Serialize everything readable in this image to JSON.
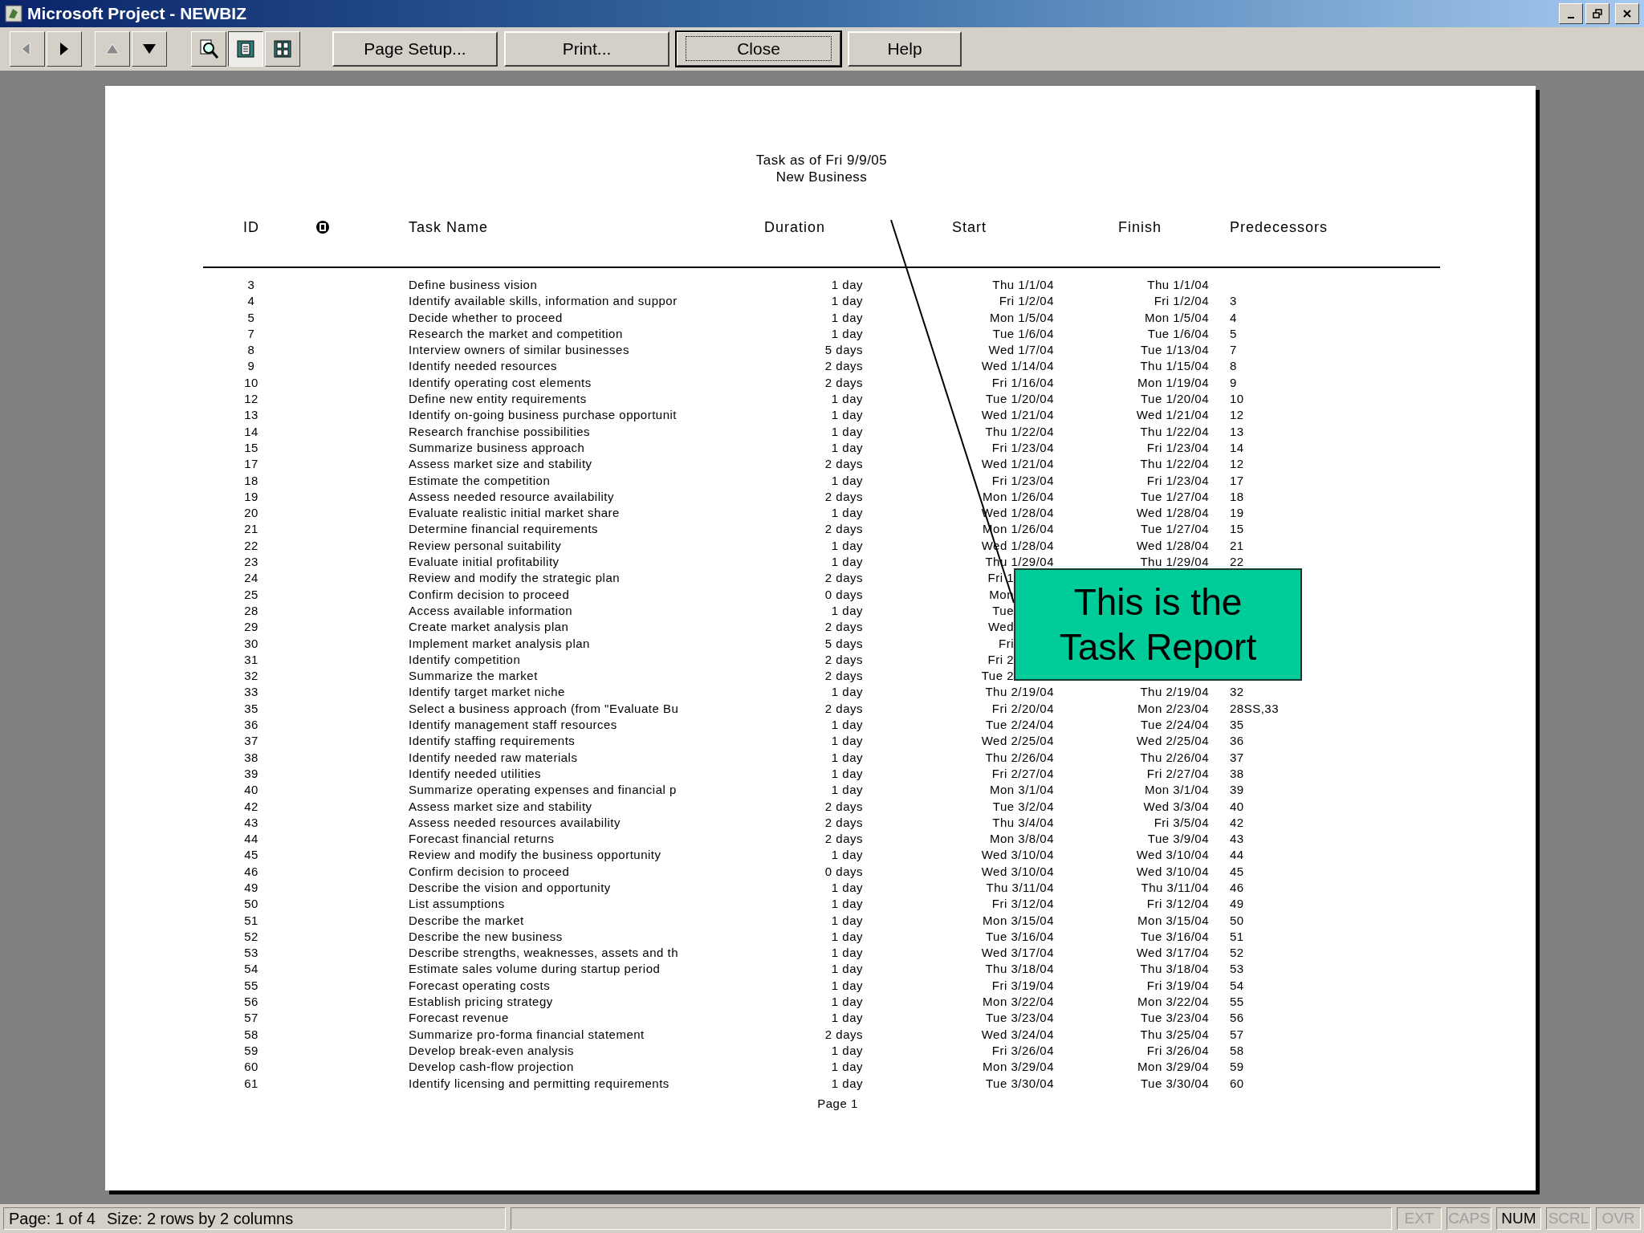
{
  "window": {
    "title": "Microsoft Project - NEWBIZ"
  },
  "toolbar": {
    "nav_buttons": [
      {
        "kind": "left",
        "disabled": true
      },
      {
        "kind": "right",
        "disabled": false
      },
      {
        "kind": "up",
        "disabled": true
      },
      {
        "kind": "down",
        "disabled": false
      }
    ],
    "view_buttons": [
      {
        "kind": "zoom",
        "pressed": false
      },
      {
        "kind": "one-page",
        "pressed": true
      },
      {
        "kind": "multi-page",
        "pressed": false
      }
    ],
    "buttons": [
      {
        "label": "Page Setup...",
        "focused": false
      },
      {
        "label": "Print...",
        "focused": false
      },
      {
        "label": "Close",
        "focused": true
      },
      {
        "label": "Help",
        "focused": false
      }
    ]
  },
  "report": {
    "title": "Task as of Fri 9/9/05",
    "subtitle": "New Business",
    "columns": {
      "id": "ID",
      "name": "Task Name",
      "duration": "Duration",
      "start": "Start",
      "finish": "Finish",
      "predecessors": "Predecessors"
    },
    "rows": [
      {
        "id": "3",
        "name": "Define business vision",
        "duration": "1 day",
        "start": "Thu 1/1/04",
        "finish": "Thu 1/1/04"
      },
      {
        "id": "4",
        "name": "Identify available skills, information and suppor",
        "duration": "1 day",
        "start": "Fri 1/2/04",
        "finish": "Fri 1/2/04",
        "predecessors": "3"
      },
      {
        "id": "5",
        "name": "Decide whether to proceed",
        "duration": "1 day",
        "start": "Mon 1/5/04",
        "finish": "Mon 1/5/04",
        "predecessors": "4"
      },
      {
        "id": "7",
        "name": "Research the market and competition",
        "duration": "1 day",
        "start": "Tue 1/6/04",
        "finish": "Tue 1/6/04",
        "predecessors": "5"
      },
      {
        "id": "8",
        "name": "Interview owners of similar businesses",
        "duration": "5 days",
        "start": "Wed 1/7/04",
        "finish": "Tue 1/13/04",
        "predecessors": "7"
      },
      {
        "id": "9",
        "name": "Identify needed resources",
        "duration": "2 days",
        "start": "Wed 1/14/04",
        "finish": "Thu 1/15/04",
        "predecessors": "8"
      },
      {
        "id": "10",
        "name": "Identify operating cost elements",
        "duration": "2 days",
        "start": "Fri 1/16/04",
        "finish": "Mon 1/19/04",
        "predecessors": "9"
      },
      {
        "id": "12",
        "name": "Define new entity requirements",
        "duration": "1 day",
        "start": "Tue 1/20/04",
        "finish": "Tue 1/20/04",
        "predecessors": "10"
      },
      {
        "id": "13",
        "name": "Identify on-going business purchase opportunit",
        "duration": "1 day",
        "start": "Wed 1/21/04",
        "finish": "Wed 1/21/04",
        "predecessors": "12"
      },
      {
        "id": "14",
        "name": "Research franchise possibilities",
        "duration": "1 day",
        "start": "Thu 1/22/04",
        "finish": "Thu 1/22/04",
        "predecessors": "13"
      },
      {
        "id": "15",
        "name": "Summarize business approach",
        "duration": "1 day",
        "start": "Fri 1/23/04",
        "finish": "Fri 1/23/04",
        "predecessors": "14"
      },
      {
        "id": "17",
        "name": "Assess market size and stability",
        "duration": "2 days",
        "start": "Wed 1/21/04",
        "finish": "Thu 1/22/04",
        "predecessors": "12"
      },
      {
        "id": "18",
        "name": "Estimate the competition",
        "duration": "1 day",
        "start": "Fri 1/23/04",
        "finish": "Fri 1/23/04",
        "predecessors": "17"
      },
      {
        "id": "19",
        "name": "Assess needed resource availability",
        "duration": "2 days",
        "start": "Mon 1/26/04",
        "finish": "Tue 1/27/04",
        "predecessors": "18"
      },
      {
        "id": "20",
        "name": "Evaluate realistic initial market share",
        "duration": "1 day",
        "start": "Wed 1/28/04",
        "finish": "Wed 1/28/04",
        "predecessors": "19"
      },
      {
        "id": "21",
        "name": "Determine financial requirements",
        "duration": "2 days",
        "start": "Mon 1/26/04",
        "finish": "Tue 1/27/04",
        "predecessors": "15"
      },
      {
        "id": "22",
        "name": "Review personal suitability",
        "duration": "1 day",
        "start": "Wed 1/28/04",
        "finish": "Wed 1/28/04",
        "predecessors": "21"
      },
      {
        "id": "23",
        "name": "Evaluate initial profitability",
        "duration": "1 day",
        "start": "Thu 1/29/04",
        "finish": "Thu 1/29/04",
        "predecessors": "22"
      },
      {
        "id": "24",
        "name": "Review and modify the strategic plan",
        "duration": "2 days",
        "start": "Fri 1"
      },
      {
        "id": "25",
        "name": "Confirm decision to proceed",
        "duration": "0 days",
        "start": "Mon"
      },
      {
        "id": "28",
        "name": "Access available information",
        "duration": "1 day",
        "start": "Tue"
      },
      {
        "id": "29",
        "name": "Create market analysis plan",
        "duration": "2 days",
        "start": "Wed"
      },
      {
        "id": "30",
        "name": "Implement market analysis plan",
        "duration": "5 days",
        "start": "Fri"
      },
      {
        "id": "31",
        "name": "Identify competition",
        "duration": "2 days",
        "start": "Fri 2"
      },
      {
        "id": "32",
        "name": "Summarize the market",
        "duration": "2 days",
        "start": "Tue 2"
      },
      {
        "id": "33",
        "name": "Identify target market niche",
        "duration": "1 day",
        "start": "Thu 2/19/04",
        "finish": "Thu 2/19/04",
        "predecessors": "32"
      },
      {
        "id": "35",
        "name": "Select a business approach (from \"Evaluate Bu",
        "duration": "2 days",
        "start": "Fri 2/20/04",
        "finish": "Mon 2/23/04",
        "predecessors": "28SS,33"
      },
      {
        "id": "36",
        "name": "Identify management staff resources",
        "duration": "1 day",
        "start": "Tue 2/24/04",
        "finish": "Tue 2/24/04",
        "predecessors": "35"
      },
      {
        "id": "37",
        "name": "Identify staffing requirements",
        "duration": "1 day",
        "start": "Wed 2/25/04",
        "finish": "Wed 2/25/04",
        "predecessors": "36"
      },
      {
        "id": "38",
        "name": "Identify needed raw materials",
        "duration": "1 day",
        "start": "Thu 2/26/04",
        "finish": "Thu 2/26/04",
        "predecessors": "37"
      },
      {
        "id": "39",
        "name": "Identify needed utilities",
        "duration": "1 day",
        "start": "Fri 2/27/04",
        "finish": "Fri 2/27/04",
        "predecessors": "38"
      },
      {
        "id": "40",
        "name": "Summarize operating expenses and financial p",
        "duration": "1 day",
        "start": "Mon 3/1/04",
        "finish": "Mon 3/1/04",
        "predecessors": "39"
      },
      {
        "id": "42",
        "name": "Assess market size and stability",
        "duration": "2 days",
        "start": "Tue 3/2/04",
        "finish": "Wed 3/3/04",
        "predecessors": "40"
      },
      {
        "id": "43",
        "name": "Assess needed resources availability",
        "duration": "2 days",
        "start": "Thu 3/4/04",
        "finish": "Fri 3/5/04",
        "predecessors": "42"
      },
      {
        "id": "44",
        "name": "Forecast financial returns",
        "duration": "2 days",
        "start": "Mon 3/8/04",
        "finish": "Tue 3/9/04",
        "predecessors": "43"
      },
      {
        "id": "45",
        "name": "Review and modify the business opportunity",
        "duration": "1 day",
        "start": "Wed 3/10/04",
        "finish": "Wed 3/10/04",
        "predecessors": "44"
      },
      {
        "id": "46",
        "name": "Confirm decision to proceed",
        "duration": "0 days",
        "start": "Wed 3/10/04",
        "finish": "Wed 3/10/04",
        "predecessors": "45"
      },
      {
        "id": "49",
        "name": "Describe the vision and opportunity",
        "duration": "1 day",
        "start": "Thu 3/11/04",
        "finish": "Thu 3/11/04",
        "predecessors": "46"
      },
      {
        "id": "50",
        "name": "List assumptions",
        "duration": "1 day",
        "start": "Fri 3/12/04",
        "finish": "Fri 3/12/04",
        "predecessors": "49"
      },
      {
        "id": "51",
        "name": "Describe the market",
        "duration": "1 day",
        "start": "Mon 3/15/04",
        "finish": "Mon 3/15/04",
        "predecessors": "50"
      },
      {
        "id": "52",
        "name": "Describe the new business",
        "duration": "1 day",
        "start": "Tue 3/16/04",
        "finish": "Tue 3/16/04",
        "predecessors": "51"
      },
      {
        "id": "53",
        "name": "Describe strengths, weaknesses, assets and th",
        "duration": "1 day",
        "start": "Wed 3/17/04",
        "finish": "Wed 3/17/04",
        "predecessors": "52"
      },
      {
        "id": "54",
        "name": "Estimate sales volume during startup period",
        "duration": "1 day",
        "start": "Thu 3/18/04",
        "finish": "Thu 3/18/04",
        "predecessors": "53"
      },
      {
        "id": "55",
        "name": "Forecast operating costs",
        "duration": "1 day",
        "start": "Fri 3/19/04",
        "finish": "Fri 3/19/04",
        "predecessors": "54"
      },
      {
        "id": "56",
        "name": "Establish pricing strategy",
        "duration": "1 day",
        "start": "Mon 3/22/04",
        "finish": "Mon 3/22/04",
        "predecessors": "55"
      },
      {
        "id": "57",
        "name": "Forecast revenue",
        "duration": "1 day",
        "start": "Tue 3/23/04",
        "finish": "Tue 3/23/04",
        "predecessors": "56"
      },
      {
        "id": "58",
        "name": "Summarize pro-forma financial statement",
        "duration": "2 days",
        "start": "Wed 3/24/04",
        "finish": "Thu 3/25/04",
        "predecessors": "57"
      },
      {
        "id": "59",
        "name": "Develop break-even analysis",
        "duration": "1 day",
        "start": "Fri 3/26/04",
        "finish": "Fri 3/26/04",
        "predecessors": "58"
      },
      {
        "id": "60",
        "name": "Develop cash-flow projection",
        "duration": "1 day",
        "start": "Mon 3/29/04",
        "finish": "Mon 3/29/04",
        "predecessors": "59"
      },
      {
        "id": "61",
        "name": "Identify licensing and permitting requirements",
        "duration": "1 day",
        "start": "Tue 3/30/04",
        "finish": "Tue 3/30/04",
        "predecessors": "60"
      }
    ],
    "footer": "Page 1"
  },
  "callout": {
    "lines": [
      "This is the",
      "Task Report"
    ]
  },
  "status_bar": {
    "page": "Page: 1 of 4",
    "size": "Size: 2 rows by 2 columns",
    "indicators": [
      {
        "label": "EXT",
        "on": false
      },
      {
        "label": "CAPS",
        "on": false
      },
      {
        "label": "NUM",
        "on": true
      },
      {
        "label": "SCRL",
        "on": false
      },
      {
        "label": "OVR",
        "on": false
      }
    ]
  }
}
